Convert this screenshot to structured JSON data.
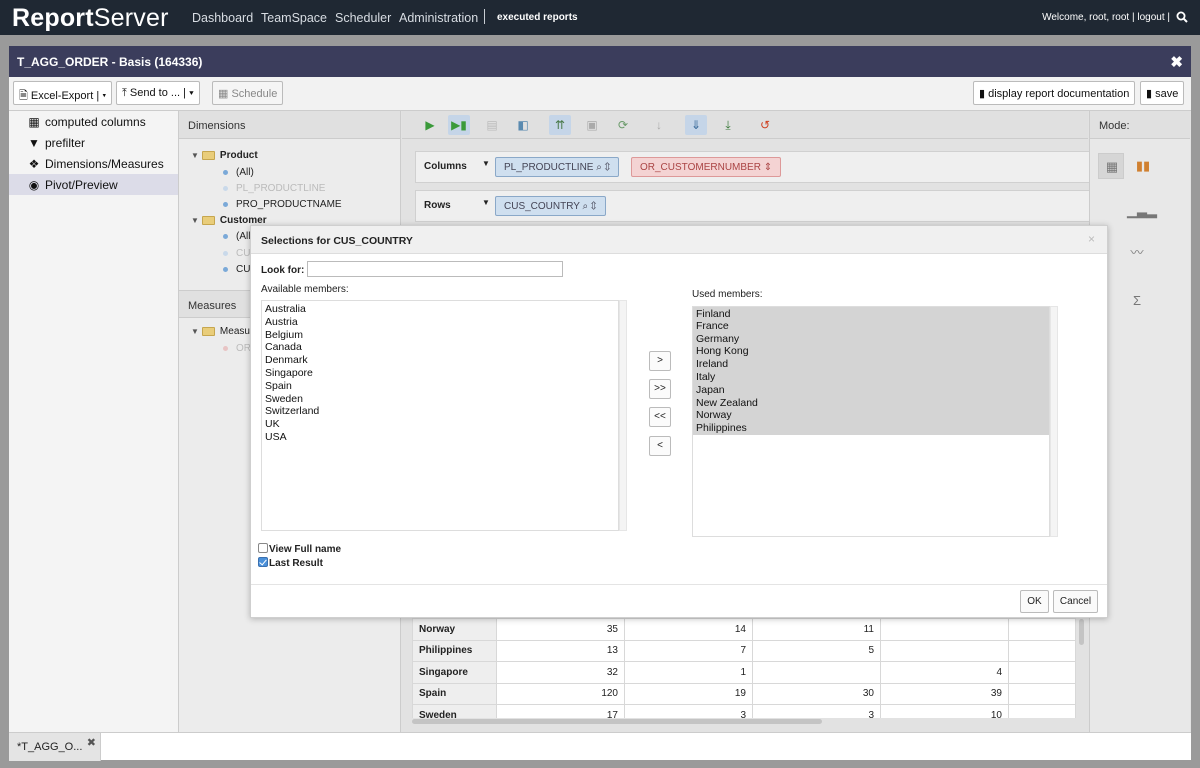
{
  "topbar": {
    "logo_bold": "Report",
    "logo_light": "Server",
    "nav": [
      "Dashboard",
      "TeamSpace",
      "Scheduler",
      "Administration"
    ],
    "executed_reports": "executed reports",
    "welcome": "Welcome, root, root",
    "logout": "logout"
  },
  "window": {
    "title": "T_AGG_ORDER - Basis (164336)",
    "close": "✖"
  },
  "toolbar": {
    "excel_export": "Excel-Export",
    "send_to": "Send to ...",
    "schedule": "Schedule",
    "report_doc": "display report documentation",
    "save": "save"
  },
  "leftnav": {
    "items": [
      {
        "label": "computed columns",
        "icon": "table-grid-icon"
      },
      {
        "label": "prefilter",
        "icon": "filter-icon"
      },
      {
        "label": "Dimensions/Measures",
        "icon": "cubes-icon"
      },
      {
        "label": "Pivot/Preview",
        "icon": "eye-icon"
      }
    ]
  },
  "dimensions": {
    "header": "Dimensions",
    "product": "Product",
    "product_children": [
      "(All)",
      "PL_PRODUCTLINE",
      "PRO_PRODUCTNAME"
    ],
    "customer": "Customer",
    "customer_children": [
      "(All",
      "CU",
      "CU"
    ],
    "measures_header": "Measures",
    "measures_folder": "Measu",
    "measures_children": [
      "OR"
    ]
  },
  "pivot": {
    "columns_label": "Columns",
    "rows_label": "Rows",
    "column_chips": [
      "PL_PRODUCTLINE",
      "OR_CUSTOMERNUMBER"
    ],
    "row_chips": [
      "CUS_COUNTRY"
    ]
  },
  "mode": {
    "header": "Mode:",
    "sigma": "Σ"
  },
  "result": {
    "rows": [
      {
        "label": "Norway",
        "values": [
          "35",
          "14",
          "11",
          "",
          ""
        ]
      },
      {
        "label": "Philippines",
        "values": [
          "13",
          "7",
          "5",
          "",
          ""
        ]
      },
      {
        "label": "Singapore",
        "values": [
          "32",
          "1",
          "",
          "4",
          ""
        ]
      },
      {
        "label": "Spain",
        "values": [
          "120",
          "19",
          "30",
          "39",
          ""
        ]
      },
      {
        "label": "Sweden",
        "values": [
          "17",
          "3",
          "3",
          "10",
          ""
        ]
      }
    ]
  },
  "dialog": {
    "title": "Selections for CUS_COUNTRY",
    "close": "×",
    "look_for_label": "Look for:",
    "look_for_value": "",
    "available_label": "Available members:",
    "used_label": "Used members:",
    "available": [
      "Australia",
      "Austria",
      "Belgium",
      "Canada",
      "Denmark",
      "Singapore",
      "Spain",
      "Sweden",
      "Switzerland",
      "UK",
      "USA"
    ],
    "used": [
      "Finland",
      "France",
      "Germany",
      "Hong Kong",
      "Ireland",
      "Italy",
      "Japan",
      "New Zealand",
      "Norway",
      "Philippines"
    ],
    "btn_add": ">",
    "btn_add_all": ">>",
    "btn_remove_all": "<<",
    "btn_remove": "<",
    "view_full_name": "View Full name",
    "view_full_name_checked": false,
    "last_result": "Last Result",
    "last_result_checked": true,
    "ok": "OK",
    "cancel": "Cancel"
  },
  "bottom_tab": {
    "label": "*T_AGG_O...",
    "close": "✖"
  }
}
